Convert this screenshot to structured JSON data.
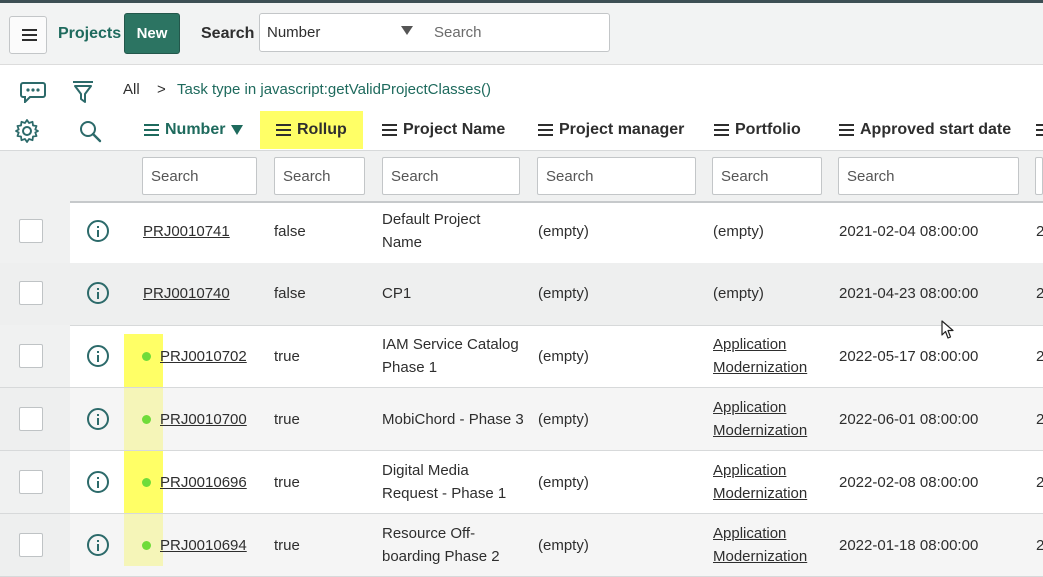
{
  "header": {
    "title": "Projects",
    "new_label": "New",
    "search_label": "Search",
    "search_field_selected": "Number",
    "search_placeholder": "Search"
  },
  "breadcrumb": {
    "all": "All",
    "separator": ">",
    "filter": "Task type in javascript:getValidProjectClasses()"
  },
  "columns": [
    {
      "label": "Number",
      "sorted": "descending"
    },
    {
      "label": "Rollup"
    },
    {
      "label": "Project Name"
    },
    {
      "label": "Project manager"
    },
    {
      "label": "Portfolio"
    },
    {
      "label": "Approved start date"
    }
  ],
  "column_search_placeholder": "Search",
  "rows": [
    {
      "number": "PRJ0010741",
      "rollup": "false",
      "name_l1": "Default Project",
      "name_l2": "Name",
      "manager": "(empty)",
      "portfolio_l1": "(empty)",
      "portfolio_l2": "",
      "start": "2021-02-04 08:00:00",
      "trunc": "2",
      "dot": false
    },
    {
      "number": "PRJ0010740",
      "rollup": "false",
      "name_l1": "CP1",
      "name_l2": "",
      "manager": "(empty)",
      "portfolio_l1": "(empty)",
      "portfolio_l2": "",
      "start": "2021-04-23 08:00:00",
      "trunc": "2",
      "dot": false
    },
    {
      "number": "PRJ0010702",
      "rollup": "true",
      "name_l1": "IAM Service Catalog",
      "name_l2": "Phase 1",
      "manager": "(empty)",
      "portfolio_l1": "Application",
      "portfolio_l2": "Modernization",
      "start": "2022-05-17 08:00:00",
      "trunc": "2",
      "dot": true
    },
    {
      "number": "PRJ0010700",
      "rollup": "true",
      "name_l1": "MobiChord - Phase 3",
      "name_l2": "",
      "manager": "(empty)",
      "portfolio_l1": "Application",
      "portfolio_l2": "Modernization",
      "start": "2022-06-01 08:00:00",
      "trunc": "2",
      "dot": true
    },
    {
      "number": "PRJ0010696",
      "rollup": "true",
      "name_l1": "Digital Media",
      "name_l2": "Request - Phase 1",
      "manager": "(empty)",
      "portfolio_l1": "Application",
      "portfolio_l2": "Modernization",
      "start": "2022-02-08 08:00:00",
      "trunc": "2",
      "dot": true
    },
    {
      "number": "PRJ0010694",
      "rollup": "true",
      "name_l1": "Resource Off-",
      "name_l2": "boarding Phase 2",
      "manager": "(empty)",
      "portfolio_l1": "Application",
      "portfolio_l2": "Modernization",
      "start": "2022-01-18 08:00:00",
      "trunc": "2",
      "dot": true
    }
  ],
  "colors": {
    "accent": "#2c7462",
    "link_green": "#1e6a5d",
    "highlight": "#ffff66",
    "dot": "#6fdc3a"
  },
  "icons": [
    "menu-icon",
    "comment-icon",
    "filter-icon",
    "gear-icon",
    "search-icon",
    "info-icon",
    "cursor-icon"
  ]
}
